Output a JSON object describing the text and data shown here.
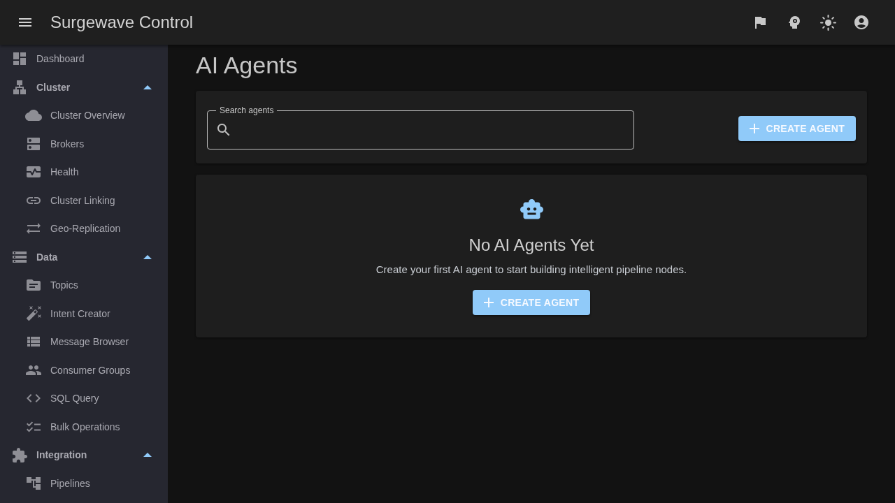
{
  "app_bar": {
    "title": "Surgewave Control"
  },
  "sidebar": {
    "items": [
      {
        "kind": "item",
        "label": "Dashboard"
      },
      {
        "kind": "group",
        "label": "Cluster",
        "expanded": true,
        "children": [
          {
            "label": "Cluster Overview"
          },
          {
            "label": "Brokers"
          },
          {
            "label": "Health"
          },
          {
            "label": "Cluster Linking"
          },
          {
            "label": "Geo-Replication"
          }
        ]
      },
      {
        "kind": "group",
        "label": "Data",
        "expanded": true,
        "children": [
          {
            "label": "Topics"
          },
          {
            "label": "Intent Creator"
          },
          {
            "label": "Message Browser"
          },
          {
            "label": "Consumer Groups"
          },
          {
            "label": "SQL Query"
          },
          {
            "label": "Bulk Operations"
          }
        ]
      },
      {
        "kind": "group",
        "label": "Integration",
        "expanded": true,
        "children": [
          {
            "label": "Pipelines"
          }
        ]
      }
    ]
  },
  "page": {
    "title": "AI Agents"
  },
  "search": {
    "label": "Search agents"
  },
  "create_button": {
    "label": "CREATE AGENT"
  },
  "empty_state": {
    "title": "No AI Agents Yet",
    "message": "Create your first AI agent to start building intelligent pipeline nodes.",
    "button": {
      "label": "CREATE AGENT"
    }
  }
}
